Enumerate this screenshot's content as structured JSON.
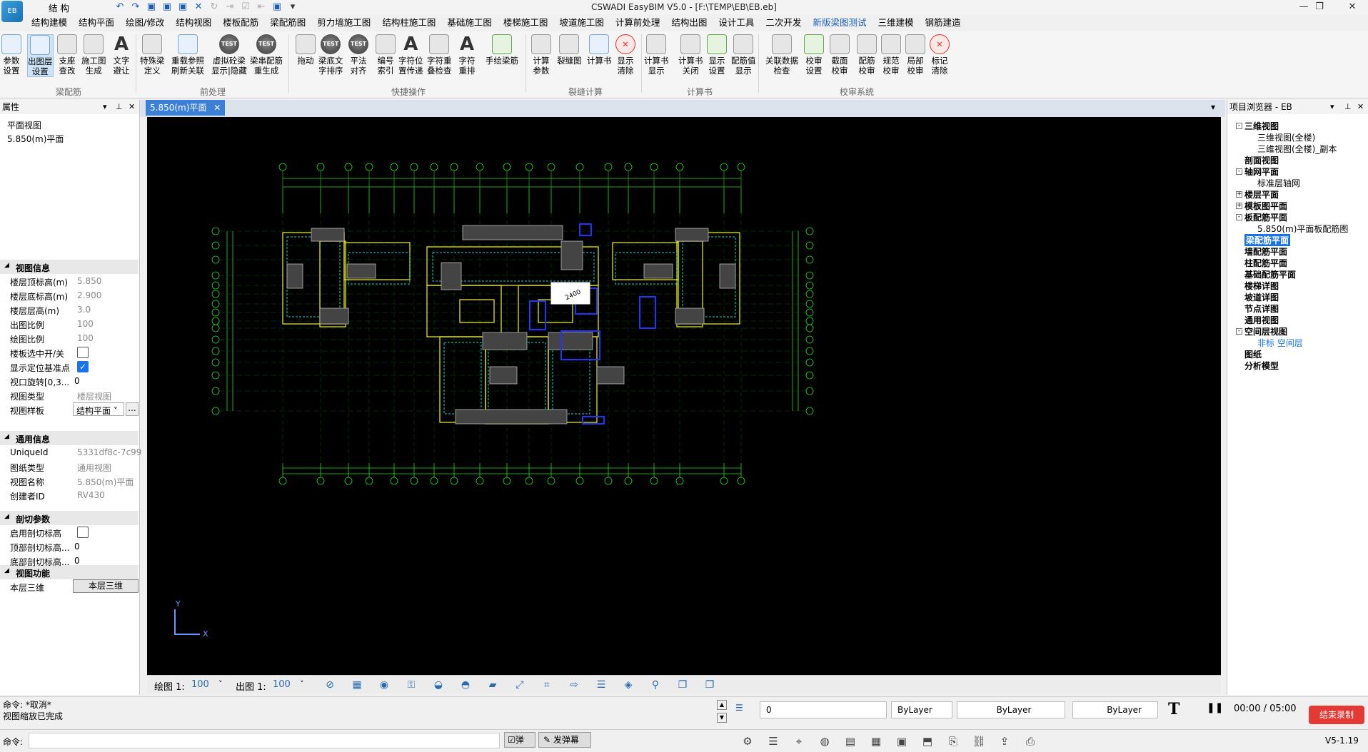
{
  "title_bar": {
    "module": "结 构",
    "title": "CSWADI EasyBIM V5.0 - [F:\\TEMP\\EB\\EB.eb]",
    "logo_text": "EB",
    "restore_symbol": "❐",
    "close_symbol": "✕",
    "minimize_symbol": "—"
  },
  "menu": [
    "结构建模",
    "结构平面",
    "绘图/修改",
    "结构视图",
    "楼板配筋",
    "梁配筋图",
    "剪力墙施工图",
    "结构柱施工图",
    "基础施工图",
    "楼梯施工图",
    "坡道施工图",
    "计算前处理",
    "结构出图",
    "设计工具",
    "二次开发",
    "新版梁图测试",
    "三维建模",
    "钢筋建造"
  ],
  "menu_active_index": 15,
  "ribbon": {
    "buttons": [
      "参数\n设置",
      "出图层\n设置",
      "支座\n查改",
      "施工图\n生成",
      "文字\n避让",
      "特殊梁\n定义",
      "重载参照\n刷新关联",
      "虚拟砼梁\n显示|隐藏",
      "梁串配筋\n重生成",
      "拖动",
      "梁底文\n字排序",
      "平法\n对齐",
      "编号\n索引",
      "字符位\n置传递",
      "字符重\n叠检查",
      "字符\n重排",
      "手绘梁筋",
      "计算\n参数",
      "裂缝图",
      "计算书",
      "显示\n清除",
      "计算书\n显示",
      "计算书\n关闭",
      "显示\n设置",
      "配筋值\n显示",
      "关联数据\n检查",
      "校审\n设置",
      "截面\n校审",
      "配筋\n校审",
      "规范\n校审",
      "局部\n校审",
      "标记\n清除"
    ],
    "test_label": "TEST",
    "groups": [
      "梁配筋",
      "前处理",
      "快捷操作",
      "裂缝计算",
      "计算书",
      "校审系统"
    ]
  },
  "properties": {
    "title": "属性",
    "view_type": "平面视图",
    "view_name": "5.850(m)平面",
    "sections": {
      "view_info": "视图信息",
      "common": "通用信息",
      "section_params": "剖切参数",
      "view_func": "视图功能"
    },
    "rows": [
      {
        "k": "楼层顶标高(m)",
        "v": "5.850"
      },
      {
        "k": "楼层底标高(m)",
        "v": "2.900"
      },
      {
        "k": "楼层层高(m)",
        "v": "3.0"
      },
      {
        "k": "出图比例",
        "v": "100"
      },
      {
        "k": "绘图比例",
        "v": "100"
      },
      {
        "k": "楼板选中开/关",
        "v": ""
      },
      {
        "k": "显示定位基准点",
        "v": ""
      },
      {
        "k": "视口旋转[0,3...",
        "v": "0"
      },
      {
        "k": "视图类型",
        "v": "楼层视图"
      },
      {
        "k": "视图样板",
        "v": "结构平面"
      },
      {
        "k": "UniqueId",
        "v": "5331df8c-7c99"
      },
      {
        "k": "图纸类型",
        "v": "通用视图"
      },
      {
        "k": "视图名称",
        "v": "5.850(m)平面"
      },
      {
        "k": "创建者ID",
        "v": "RV430"
      },
      {
        "k": "启用剖切标高",
        "v": ""
      },
      {
        "k": "顶部剖切标高...",
        "v": "0"
      },
      {
        "k": "底部剖切标高...",
        "v": "0"
      },
      {
        "k": "本层三维",
        "v": "本层三维"
      }
    ],
    "check_mark": "✓",
    "more_button": "...",
    "dropdown_arrow": "˅",
    "pin": "⊥",
    "close": "✕",
    "menu_arrow": "▾"
  },
  "document": {
    "tab": "5.850(m)平面",
    "tab_close": "✕",
    "axis_x": "X",
    "axis_y": "Y",
    "draw_scale_label": "绘图 1:",
    "draw_scale": "100",
    "out_scale_label": "出图 1:",
    "out_scale": "100",
    "dim_label": "2400"
  },
  "browser": {
    "title": "项目浏览器 - EB",
    "nodes": [
      "三维视图",
      "三维视图(全楼)",
      "三维视图(全楼)_副本",
      "剖面视图",
      "轴网平面",
      "标准层轴网",
      "楼层平面",
      "模板图平面",
      "板配筋平面",
      "5.850(m)平面板配筋图",
      "梁配筋平面",
      "墙配筋平面",
      "柱配筋平面",
      "基础配筋平面",
      "楼梯详图",
      "坡道详图",
      "节点详图",
      "通用视图",
      "空间层视图",
      "非标 空间层",
      "图纸",
      "分析模型"
    ]
  },
  "command": {
    "line1": "命令: *取消*",
    "line2": "视图缩放已完成",
    "prompt": "命令:",
    "layer": "0",
    "bylayer1": "ByLayer",
    "bylayer2": "ByLayer",
    "bylayer3": "ByLayer",
    "recording_time": "00:00 / 05:00",
    "stop_record": "结束录制",
    "toggle_label": "弹",
    "danmu_label": "发弹幕",
    "version": "V5-1.19"
  },
  "colors": {
    "accent": "#1a73e8",
    "canvas_bg": "#000000",
    "cad_green": "#22dd22",
    "cad_yellow": "#e6e600",
    "cad_cyan": "#22cccc",
    "cad_blue": "#2233ff",
    "record_red": "#e53935"
  }
}
